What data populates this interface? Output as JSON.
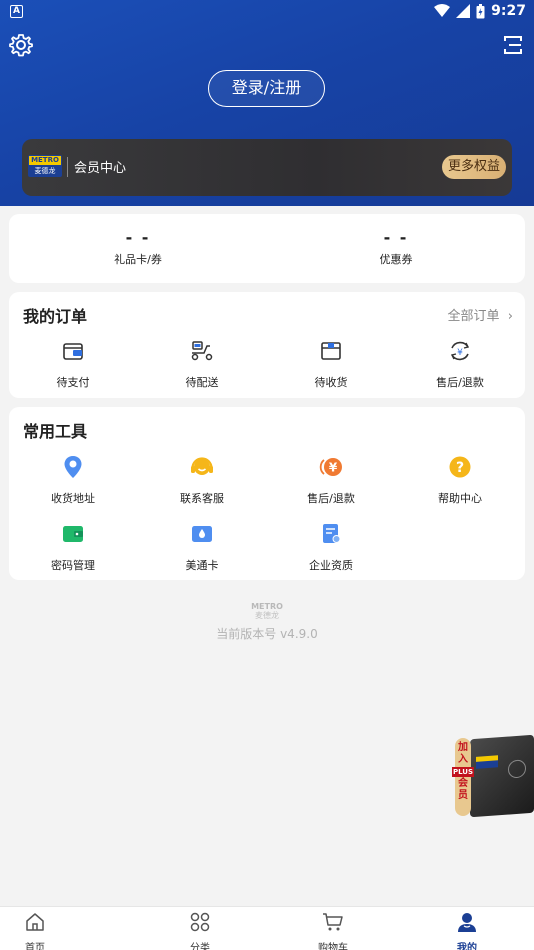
{
  "status_bar": {
    "indicator": "A",
    "time": "9:27"
  },
  "header": {
    "login_label": "登录/注册",
    "icons": [
      "gear-icon",
      "scan-icon"
    ]
  },
  "member": {
    "logo_top": "METRO",
    "logo_bottom": "麦德龙",
    "title": "会员中心",
    "more_benefits": "更多权益"
  },
  "balances": [
    {
      "value": "- -",
      "label": "礼品卡/券"
    },
    {
      "value": "- -",
      "label": "优惠券"
    }
  ],
  "orders": {
    "title": "我的订单",
    "all_link": "全部订单",
    "items": [
      {
        "label": "待支付",
        "icon": "wallet-icon"
      },
      {
        "label": "待配送",
        "icon": "scooter-icon"
      },
      {
        "label": "待收货",
        "icon": "package-icon"
      },
      {
        "label": "售后/退款",
        "icon": "refund-icon"
      }
    ]
  },
  "tools": {
    "title": "常用工具",
    "items": [
      {
        "label": "收货地址",
        "icon": "location-icon"
      },
      {
        "label": "联系客服",
        "icon": "headset-icon"
      },
      {
        "label": "售后/退款",
        "icon": "yuan-icon"
      },
      {
        "label": "帮助中心",
        "icon": "help-icon"
      },
      {
        "label": "密码管理",
        "icon": "password-wallet-icon"
      },
      {
        "label": "美通卡",
        "icon": "card-icon"
      },
      {
        "label": "企业资质",
        "icon": "certificate-icon"
      }
    ]
  },
  "footer": {
    "logo_top": "METRO",
    "logo_bottom": "麦德龙",
    "version_text": "当前版本号 v4.9.0"
  },
  "plus_badge": {
    "line1": "加",
    "line2": "入",
    "plus": "PLUS",
    "line3": "会",
    "line4": "员"
  },
  "bottom_nav": [
    {
      "label": "首页",
      "icon": "home-icon",
      "active": false
    },
    {
      "label": "分类",
      "icon": "category-icon",
      "active": false
    },
    {
      "label": "购物车",
      "icon": "cart-icon",
      "active": false
    },
    {
      "label": "我的",
      "icon": "profile-icon",
      "active": true
    }
  ],
  "colors": {
    "brand_blue": "#1b3f94",
    "hero_blue": "#1743a6",
    "gold": "#e9c88f",
    "metro_yellow": "#f4c900"
  }
}
